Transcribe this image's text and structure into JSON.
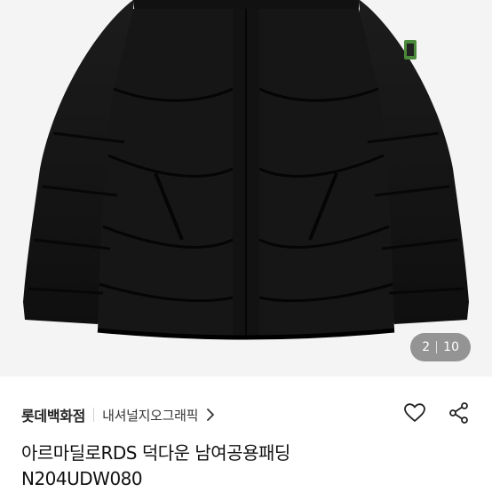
{
  "gallery": {
    "image_alt": "black down puffer jacket",
    "current_index": "2",
    "total": "10"
  },
  "store": {
    "name": "롯데백화점",
    "brand": "내셔널지오그래픽"
  },
  "product": {
    "title_line1": "아르마딜로RDS 덕다운 남여공용패딩",
    "title_line2": "N204UDW080"
  },
  "icons": {
    "chevron": "chevron-right-icon",
    "like": "heart-icon",
    "share": "share-icon"
  },
  "colors": {
    "jacket": "#141414",
    "background": "#f4f4f4",
    "badge": "#4b8a3a"
  }
}
